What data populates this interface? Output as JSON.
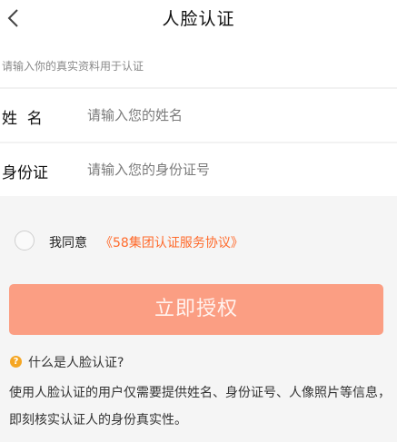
{
  "header": {
    "title": "人脸认证"
  },
  "hint": "请输入你的真实资料用于认证",
  "form": {
    "name_label": "姓  名",
    "name_placeholder": "请输入您的姓名",
    "id_label": "身份证",
    "id_placeholder": "请输入您的身份证号"
  },
  "agreement": {
    "prefix": "我同意",
    "link": "《58集团认证服务协议》",
    "checked": false
  },
  "authorize_button": "立即授权",
  "faq": {
    "title": "什么是人脸认证?",
    "description": "使用人脸认证的用户仅需要提供姓名、身份证号、人像照片等信息，即刻核实认证人的身份真实性。"
  },
  "colors": {
    "accent": "#ff6a2b",
    "button": "#fb9e83",
    "faq_icon": "#f5a623",
    "background": "#f5f5f5"
  }
}
